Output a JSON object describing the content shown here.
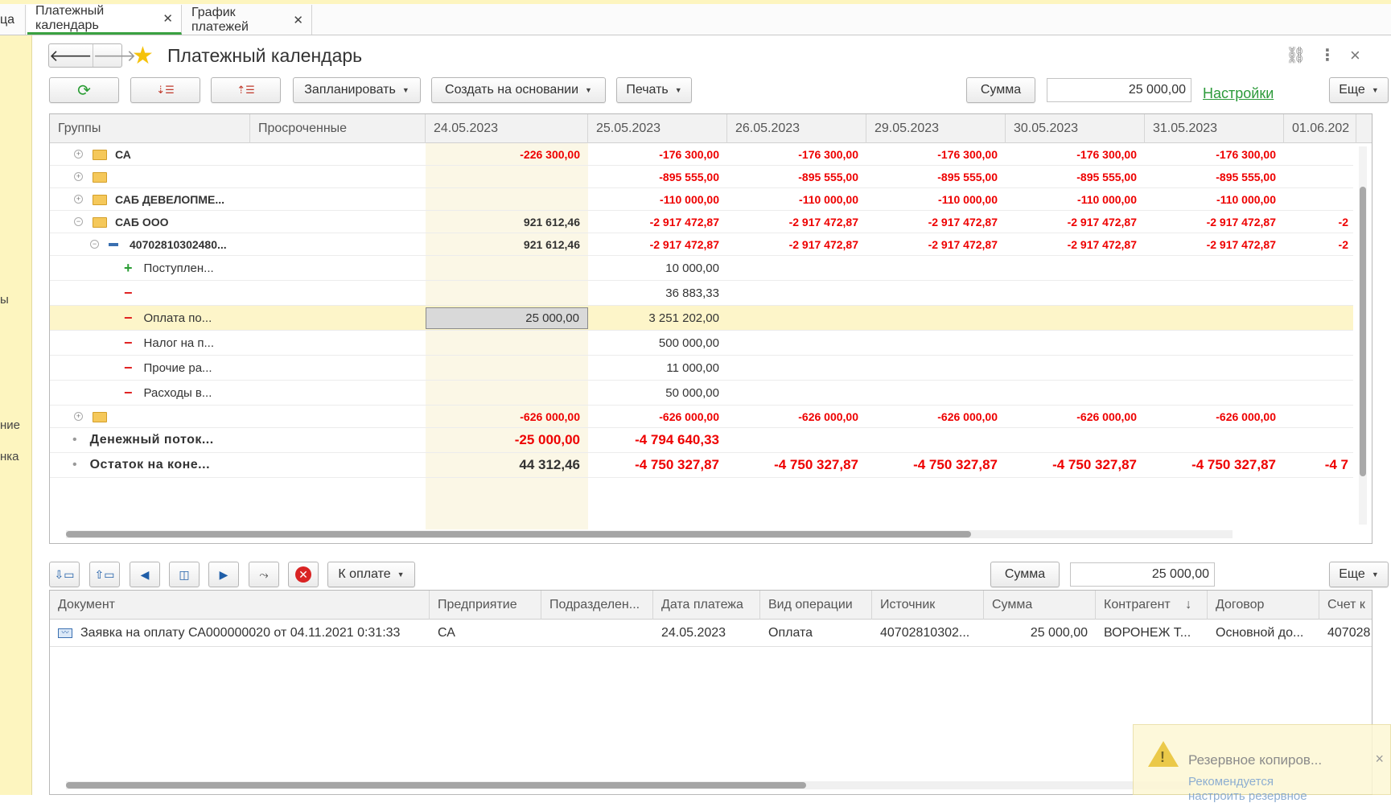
{
  "tabs": [
    {
      "label": "ца",
      "close": ""
    },
    {
      "label": "Платежный календарь",
      "close": "✕"
    },
    {
      "label": "График платежей",
      "close": "✕"
    }
  ],
  "left_strip": [
    "ы",
    "ние",
    "нка"
  ],
  "header": {
    "back": "🡐",
    "forward": "🡒",
    "title": "Платежный календарь",
    "more_menu": "⋮",
    "close": "×",
    "link_icon": "🔗"
  },
  "toolbar": {
    "refresh": "⟳",
    "sort_down": "⇣☰",
    "sort_up": "⇡☰",
    "plan": "Запланировать",
    "create_based": "Создать на основании",
    "print": "Печать",
    "sum_label": "Сумма",
    "sum_value": "25 000,00",
    "settings": "Настройки",
    "more": "Еще"
  },
  "grid": {
    "headers": [
      "Группы",
      "Просроченные",
      "24.05.2023",
      "25.05.2023",
      "26.05.2023",
      "29.05.2023",
      "30.05.2023",
      "31.05.2023",
      "01.06.202"
    ],
    "rows": [
      {
        "kind": "folder",
        "name": "СА",
        "cells": [
          "",
          "-226 300,00",
          "-176 300,00",
          "-176 300,00",
          "-176 300,00",
          "-176 300,00",
          "-176 300,00",
          ""
        ]
      },
      {
        "kind": "folder",
        "name": "",
        "cells": [
          "",
          "",
          "-895 555,00",
          "-895 555,00",
          "-895 555,00",
          "-895 555,00",
          "-895 555,00",
          ""
        ]
      },
      {
        "kind": "folder",
        "name": "САБ ДЕВЕЛОПМЕ...",
        "cells": [
          "",
          "",
          "-110 000,00",
          "-110 000,00",
          "-110 000,00",
          "-110 000,00",
          "-110 000,00",
          ""
        ]
      },
      {
        "kind": "folder-open",
        "name": "САБ ООО",
        "cells": [
          "",
          "921 612,46",
          "-2 917 472,87",
          "-2 917 472,87",
          "-2 917 472,87",
          "-2 917 472,87",
          "-2 917 472,87",
          "-2"
        ]
      },
      {
        "kind": "account",
        "name": "40702810302480...",
        "cells": [
          "",
          "921 612,46",
          "-2 917 472,87",
          "-2 917 472,87",
          "-2 917 472,87",
          "-2 917 472,87",
          "-2 917 472,87",
          "-2"
        ]
      },
      {
        "kind": "plus",
        "name": "Поступлен...",
        "cells": [
          "",
          "",
          "10 000,00",
          "",
          "",
          "",
          "",
          ""
        ]
      },
      {
        "kind": "minus",
        "name": "",
        "cells": [
          "",
          "",
          "36 883,33",
          "",
          "",
          "",
          "",
          ""
        ]
      },
      {
        "kind": "minus-sel",
        "name": "Оплата по...",
        "cells": [
          "",
          "25 000,00",
          "3 251 202,00",
          "",
          "",
          "",
          "",
          ""
        ]
      },
      {
        "kind": "minus",
        "name": "Налог на п...",
        "cells": [
          "",
          "",
          "500 000,00",
          "",
          "",
          "",
          "",
          ""
        ]
      },
      {
        "kind": "minus",
        "name": "Прочие ра...",
        "cells": [
          "",
          "",
          "11 000,00",
          "",
          "",
          "",
          "",
          ""
        ]
      },
      {
        "kind": "minus",
        "name": "Расходы в...",
        "cells": [
          "",
          "",
          "50 000,00",
          "",
          "",
          "",
          "",
          ""
        ]
      },
      {
        "kind": "folder",
        "name": "",
        "cells": [
          "",
          "-626 000,00",
          "-626 000,00",
          "-626 000,00",
          "-626 000,00",
          "-626 000,00",
          "-626 000,00",
          ""
        ]
      },
      {
        "kind": "total",
        "name": "Денежный поток...",
        "cells": [
          "",
          "-25 000,00",
          "-4 794 640,33",
          "",
          "",
          "",
          "",
          ""
        ]
      },
      {
        "kind": "total",
        "name": "Остаток на коне...",
        "cells": [
          "",
          "44 312,46",
          "-4 750 327,87",
          "-4 750 327,87",
          "-4 750 327,87",
          "-4 750 327,87",
          "-4 750 327,87",
          "-4 7"
        ]
      }
    ]
  },
  "bottom_toolbar": {
    "to_pay": "К оплате",
    "sum_label": "Сумма",
    "sum_value": "25 000,00",
    "more": "Еще"
  },
  "documents": {
    "headers": [
      "Документ",
      "Предприятие",
      "Подразделен...",
      "Дата платежа",
      "Вид операции",
      "Источник",
      "Сумма",
      "Контрагент",
      "Договор",
      "Счет к"
    ],
    "sort_icon": "↓",
    "rows": [
      {
        "doc": "Заявка на оплату СА000000020 от 04.11.2021 0:31:33",
        "org": "СА",
        "dept": "",
        "date": "24.05.2023",
        "op": "Оплата",
        "src": "40702810302...",
        "sum": "25 000,00",
        "partner": "ВОРОНЕЖ Т...",
        "contract": "Основной до...",
        "acc": "407028"
      }
    ]
  },
  "toast": {
    "title": "Резервное копиров...",
    "line1": "Рекомендуется",
    "line2": "настроить резервное",
    "close": "×"
  },
  "colors": {
    "accent_green": "#2c9a3a",
    "negative": "#ee0000",
    "selection": "#fdf5c9",
    "strip": "#fdf5bf"
  }
}
